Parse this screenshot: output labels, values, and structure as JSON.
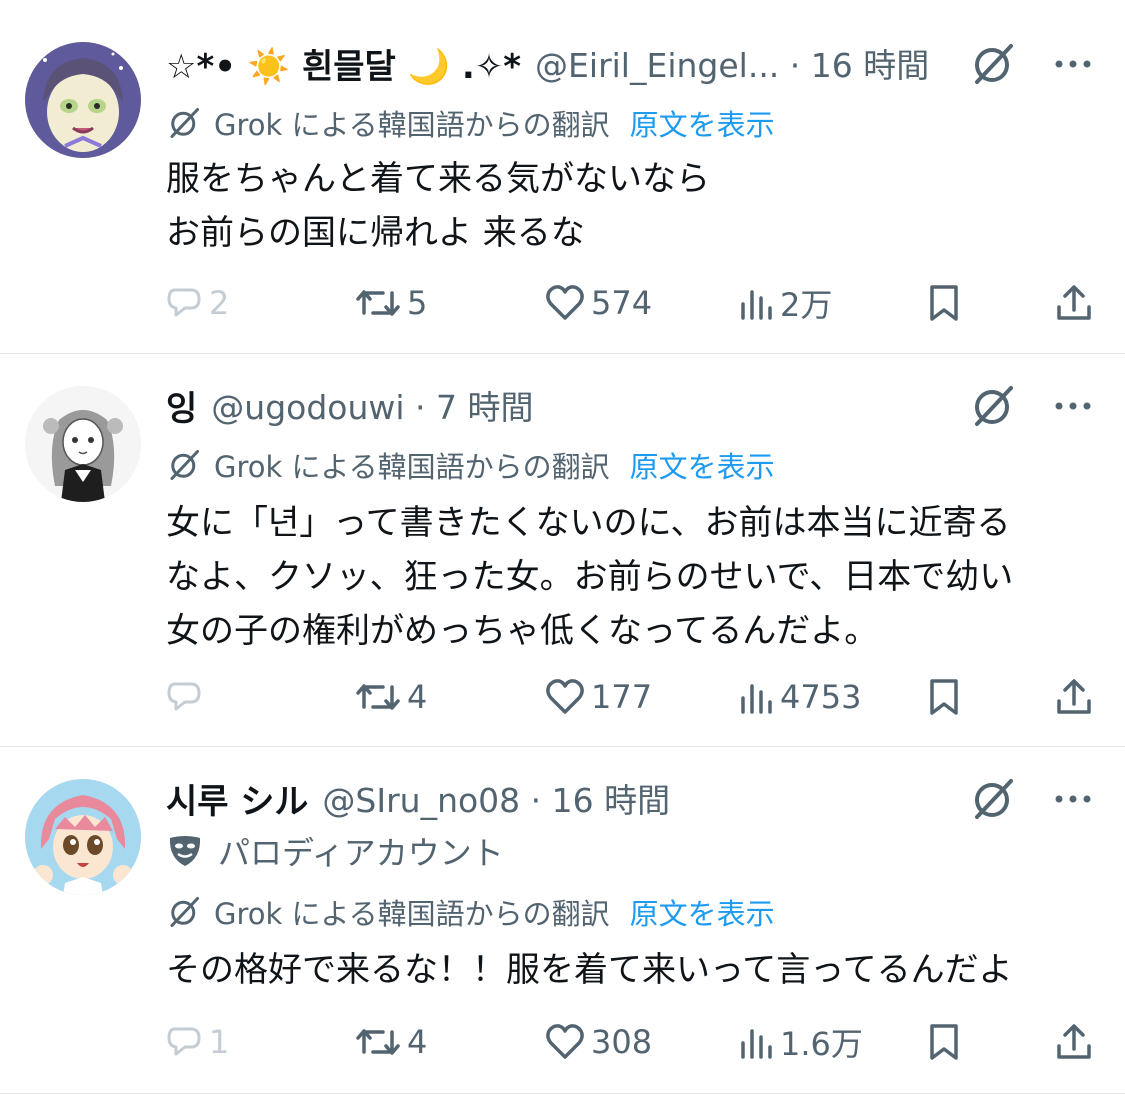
{
  "translation": {
    "label": "Grok による韓国語からの翻訳",
    "show_original": "原文を表示"
  },
  "tweets": [
    {
      "display_name": "☆*• ☀️ 흰믈달 🌙 .✧*",
      "handle_meta": "@Eiril_Eingel... · 16 時間",
      "body_lines": [
        "服をちゃんと着て来る気がないなら",
        "お前らの国に帰れよ 来るな"
      ],
      "replies": "2",
      "retweets": "5",
      "likes": "574",
      "views": "2万",
      "avatar_colors": {
        "bg": "#5e5a9c",
        "face": "#f2ecd2",
        "hair": "#5b5277",
        "eyes": "#b6d48a"
      }
    },
    {
      "display_name": "잉",
      "handle_meta": "@ugodouwi · 7 時間",
      "body_lines": [
        "女に「년」って書きたくないのに、お前は本当に近寄る",
        "なよ、クソッ、狂った女。お前らのせいで、日本で幼い",
        "女の子の権利がめっちゃ低くなってるんだよ。"
      ],
      "replies": "",
      "retweets": "4",
      "likes": "177",
      "views": "4753",
      "avatar_colors": {
        "bg": "#f5f5f5",
        "face": "#ffffff",
        "hair": "#9a9a9a",
        "eyes": "#333333"
      }
    },
    {
      "display_name": "시루 シル",
      "handle_meta": "@SIru_no08 · 16 時間",
      "parody_label": "パロディアカウント",
      "body_lines": [
        "その格好で来るな！！服を着て来いって言ってるんだよ"
      ],
      "replies": "1",
      "retweets": "4",
      "likes": "308",
      "views": "1.6万",
      "avatar_colors": {
        "bg": "#a6d8f0",
        "face": "#fbe6d2",
        "hair": "#e88a9c",
        "eyes": "#6b4a2a"
      }
    }
  ],
  "colors": {
    "text": "#0f1419",
    "secondary": "#536471",
    "link": "#1d9bf0",
    "divider": "#e6e9ec"
  },
  "icons": [
    "grok-icon",
    "more-icon",
    "reply-icon",
    "retweet-icon",
    "like-icon",
    "views-icon",
    "bookmark-icon",
    "share-icon",
    "parody-mask-icon",
    "translate-icon"
  ]
}
